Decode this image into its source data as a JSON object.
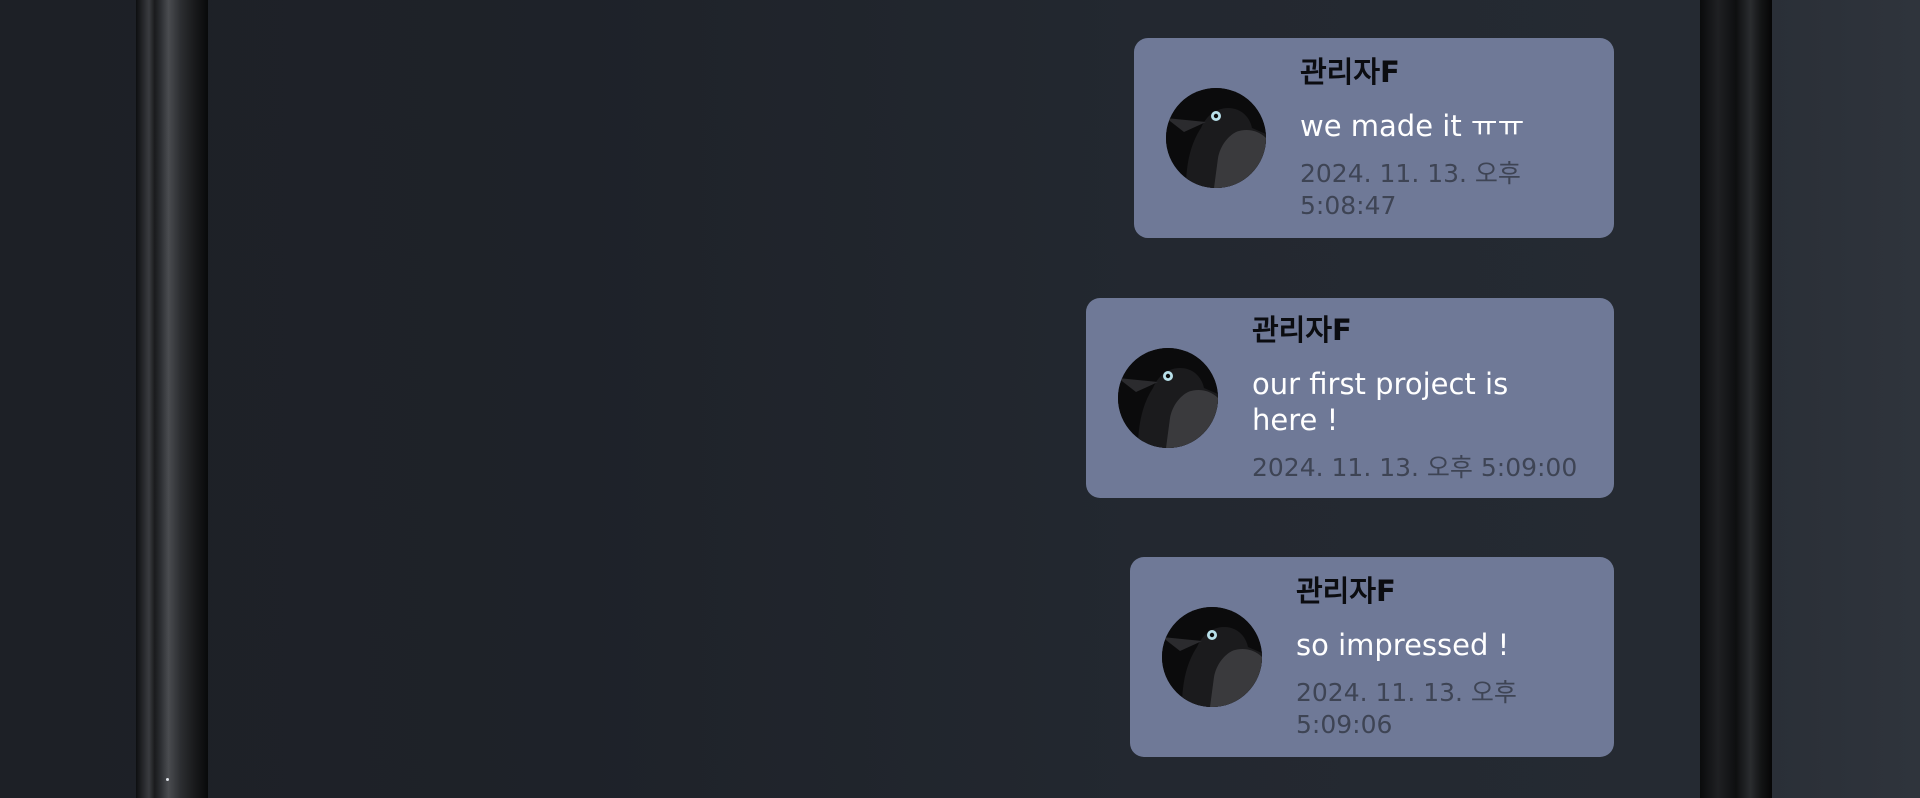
{
  "messages": [
    {
      "author": "관리자F",
      "text": "we made it ㅠㅠ",
      "timestamp": "2024. 11. 13. 오후 5:08:47",
      "avatar_icon": "crow-avatar-icon"
    },
    {
      "author": "관리자F",
      "text": "our first project is here !",
      "timestamp": "2024. 11. 13. 오후 5:09:00",
      "avatar_icon": "crow-avatar-icon"
    },
    {
      "author": "관리자F",
      "text": "so impressed !",
      "timestamp": "2024. 11. 13. 오후 5:09:06",
      "avatar_icon": "crow-avatar-icon"
    }
  ],
  "colors": {
    "card_background": "#6f7997",
    "author_text": "#0b0c10",
    "message_text": "#ffffff",
    "timestamp_text": "#3e4454"
  }
}
